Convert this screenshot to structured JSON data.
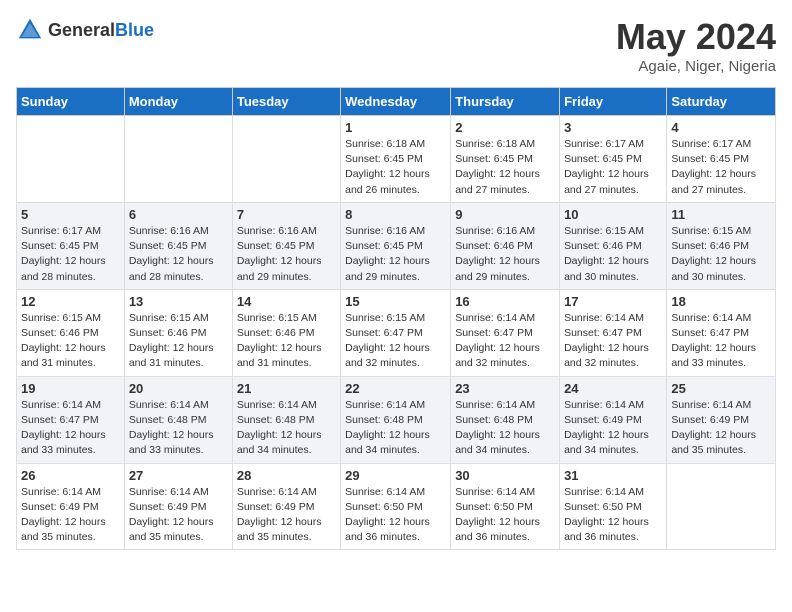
{
  "header": {
    "logo_general": "General",
    "logo_blue": "Blue",
    "month": "May 2024",
    "location": "Agaie, Niger, Nigeria"
  },
  "weekdays": [
    "Sunday",
    "Monday",
    "Tuesday",
    "Wednesday",
    "Thursday",
    "Friday",
    "Saturday"
  ],
  "weeks": [
    [
      {
        "day": "",
        "info": ""
      },
      {
        "day": "",
        "info": ""
      },
      {
        "day": "",
        "info": ""
      },
      {
        "day": "1",
        "info": "Sunrise: 6:18 AM\nSunset: 6:45 PM\nDaylight: 12 hours and 26 minutes."
      },
      {
        "day": "2",
        "info": "Sunrise: 6:18 AM\nSunset: 6:45 PM\nDaylight: 12 hours and 27 minutes."
      },
      {
        "day": "3",
        "info": "Sunrise: 6:17 AM\nSunset: 6:45 PM\nDaylight: 12 hours and 27 minutes."
      },
      {
        "day": "4",
        "info": "Sunrise: 6:17 AM\nSunset: 6:45 PM\nDaylight: 12 hours and 27 minutes."
      }
    ],
    [
      {
        "day": "5",
        "info": "Sunrise: 6:17 AM\nSunset: 6:45 PM\nDaylight: 12 hours and 28 minutes."
      },
      {
        "day": "6",
        "info": "Sunrise: 6:16 AM\nSunset: 6:45 PM\nDaylight: 12 hours and 28 minutes."
      },
      {
        "day": "7",
        "info": "Sunrise: 6:16 AM\nSunset: 6:45 PM\nDaylight: 12 hours and 29 minutes."
      },
      {
        "day": "8",
        "info": "Sunrise: 6:16 AM\nSunset: 6:45 PM\nDaylight: 12 hours and 29 minutes."
      },
      {
        "day": "9",
        "info": "Sunrise: 6:16 AM\nSunset: 6:46 PM\nDaylight: 12 hours and 29 minutes."
      },
      {
        "day": "10",
        "info": "Sunrise: 6:15 AM\nSunset: 6:46 PM\nDaylight: 12 hours and 30 minutes."
      },
      {
        "day": "11",
        "info": "Sunrise: 6:15 AM\nSunset: 6:46 PM\nDaylight: 12 hours and 30 minutes."
      }
    ],
    [
      {
        "day": "12",
        "info": "Sunrise: 6:15 AM\nSunset: 6:46 PM\nDaylight: 12 hours and 31 minutes."
      },
      {
        "day": "13",
        "info": "Sunrise: 6:15 AM\nSunset: 6:46 PM\nDaylight: 12 hours and 31 minutes."
      },
      {
        "day": "14",
        "info": "Sunrise: 6:15 AM\nSunset: 6:46 PM\nDaylight: 12 hours and 31 minutes."
      },
      {
        "day": "15",
        "info": "Sunrise: 6:15 AM\nSunset: 6:47 PM\nDaylight: 12 hours and 32 minutes."
      },
      {
        "day": "16",
        "info": "Sunrise: 6:14 AM\nSunset: 6:47 PM\nDaylight: 12 hours and 32 minutes."
      },
      {
        "day": "17",
        "info": "Sunrise: 6:14 AM\nSunset: 6:47 PM\nDaylight: 12 hours and 32 minutes."
      },
      {
        "day": "18",
        "info": "Sunrise: 6:14 AM\nSunset: 6:47 PM\nDaylight: 12 hours and 33 minutes."
      }
    ],
    [
      {
        "day": "19",
        "info": "Sunrise: 6:14 AM\nSunset: 6:47 PM\nDaylight: 12 hours and 33 minutes."
      },
      {
        "day": "20",
        "info": "Sunrise: 6:14 AM\nSunset: 6:48 PM\nDaylight: 12 hours and 33 minutes."
      },
      {
        "day": "21",
        "info": "Sunrise: 6:14 AM\nSunset: 6:48 PM\nDaylight: 12 hours and 34 minutes."
      },
      {
        "day": "22",
        "info": "Sunrise: 6:14 AM\nSunset: 6:48 PM\nDaylight: 12 hours and 34 minutes."
      },
      {
        "day": "23",
        "info": "Sunrise: 6:14 AM\nSunset: 6:48 PM\nDaylight: 12 hours and 34 minutes."
      },
      {
        "day": "24",
        "info": "Sunrise: 6:14 AM\nSunset: 6:49 PM\nDaylight: 12 hours and 34 minutes."
      },
      {
        "day": "25",
        "info": "Sunrise: 6:14 AM\nSunset: 6:49 PM\nDaylight: 12 hours and 35 minutes."
      }
    ],
    [
      {
        "day": "26",
        "info": "Sunrise: 6:14 AM\nSunset: 6:49 PM\nDaylight: 12 hours and 35 minutes."
      },
      {
        "day": "27",
        "info": "Sunrise: 6:14 AM\nSunset: 6:49 PM\nDaylight: 12 hours and 35 minutes."
      },
      {
        "day": "28",
        "info": "Sunrise: 6:14 AM\nSunset: 6:49 PM\nDaylight: 12 hours and 35 minutes."
      },
      {
        "day": "29",
        "info": "Sunrise: 6:14 AM\nSunset: 6:50 PM\nDaylight: 12 hours and 36 minutes."
      },
      {
        "day": "30",
        "info": "Sunrise: 6:14 AM\nSunset: 6:50 PM\nDaylight: 12 hours and 36 minutes."
      },
      {
        "day": "31",
        "info": "Sunrise: 6:14 AM\nSunset: 6:50 PM\nDaylight: 12 hours and 36 minutes."
      },
      {
        "day": "",
        "info": ""
      }
    ]
  ]
}
